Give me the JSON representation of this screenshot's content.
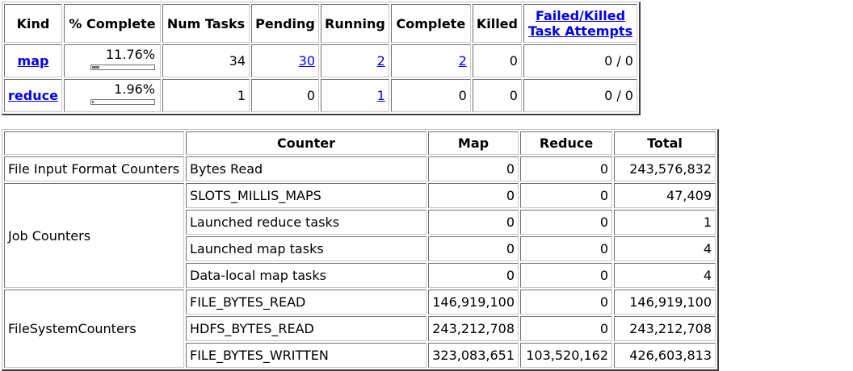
{
  "tasks_table": {
    "headers": {
      "kind": "Kind",
      "pct_complete": "% Complete",
      "num_tasks": "Num Tasks",
      "pending": "Pending",
      "running": "Running",
      "complete": "Complete",
      "killed": "Killed",
      "failed_killed_line1": "Failed/Killed",
      "failed_killed_line2": "Task Attempts"
    },
    "rows": [
      {
        "kind": "map",
        "pct_complete": "11.76%",
        "progress_fraction": 0.1176,
        "num_tasks": "34",
        "pending": "30",
        "running": "2",
        "complete": "2",
        "killed": "0",
        "failed_killed": "0 / 0"
      },
      {
        "kind": "reduce",
        "pct_complete": "1.96%",
        "progress_fraction": 0.0196,
        "num_tasks": "1",
        "pending": "0",
        "running": "1",
        "complete": "0",
        "killed": "0",
        "failed_killed": "0 / 0"
      }
    ]
  },
  "counters_table": {
    "headers": {
      "group": "",
      "counter": "Counter",
      "map": "Map",
      "reduce": "Reduce",
      "total": "Total"
    },
    "groups": [
      {
        "name": "File Input Format Counters",
        "counters": [
          {
            "name": "Bytes Read",
            "map": "0",
            "reduce": "0",
            "total": "243,576,832"
          }
        ]
      },
      {
        "name": "Job Counters",
        "counters": [
          {
            "name": "SLOTS_MILLIS_MAPS",
            "map": "0",
            "reduce": "0",
            "total": "47,409"
          },
          {
            "name": "Launched reduce tasks",
            "map": "0",
            "reduce": "0",
            "total": "1"
          },
          {
            "name": "Launched map tasks",
            "map": "0",
            "reduce": "0",
            "total": "4"
          },
          {
            "name": "Data-local map tasks",
            "map": "0",
            "reduce": "0",
            "total": "4"
          }
        ]
      },
      {
        "name": "FileSystemCounters",
        "counters": [
          {
            "name": "FILE_BYTES_READ",
            "map": "146,919,100",
            "reduce": "0",
            "total": "146,919,100"
          },
          {
            "name": "HDFS_BYTES_READ",
            "map": "243,212,708",
            "reduce": "0",
            "total": "243,212,708"
          },
          {
            "name": "FILE_BYTES_WRITTEN",
            "map": "323,083,651",
            "reduce": "103,520,162",
            "total": "426,603,813"
          }
        ]
      }
    ]
  }
}
